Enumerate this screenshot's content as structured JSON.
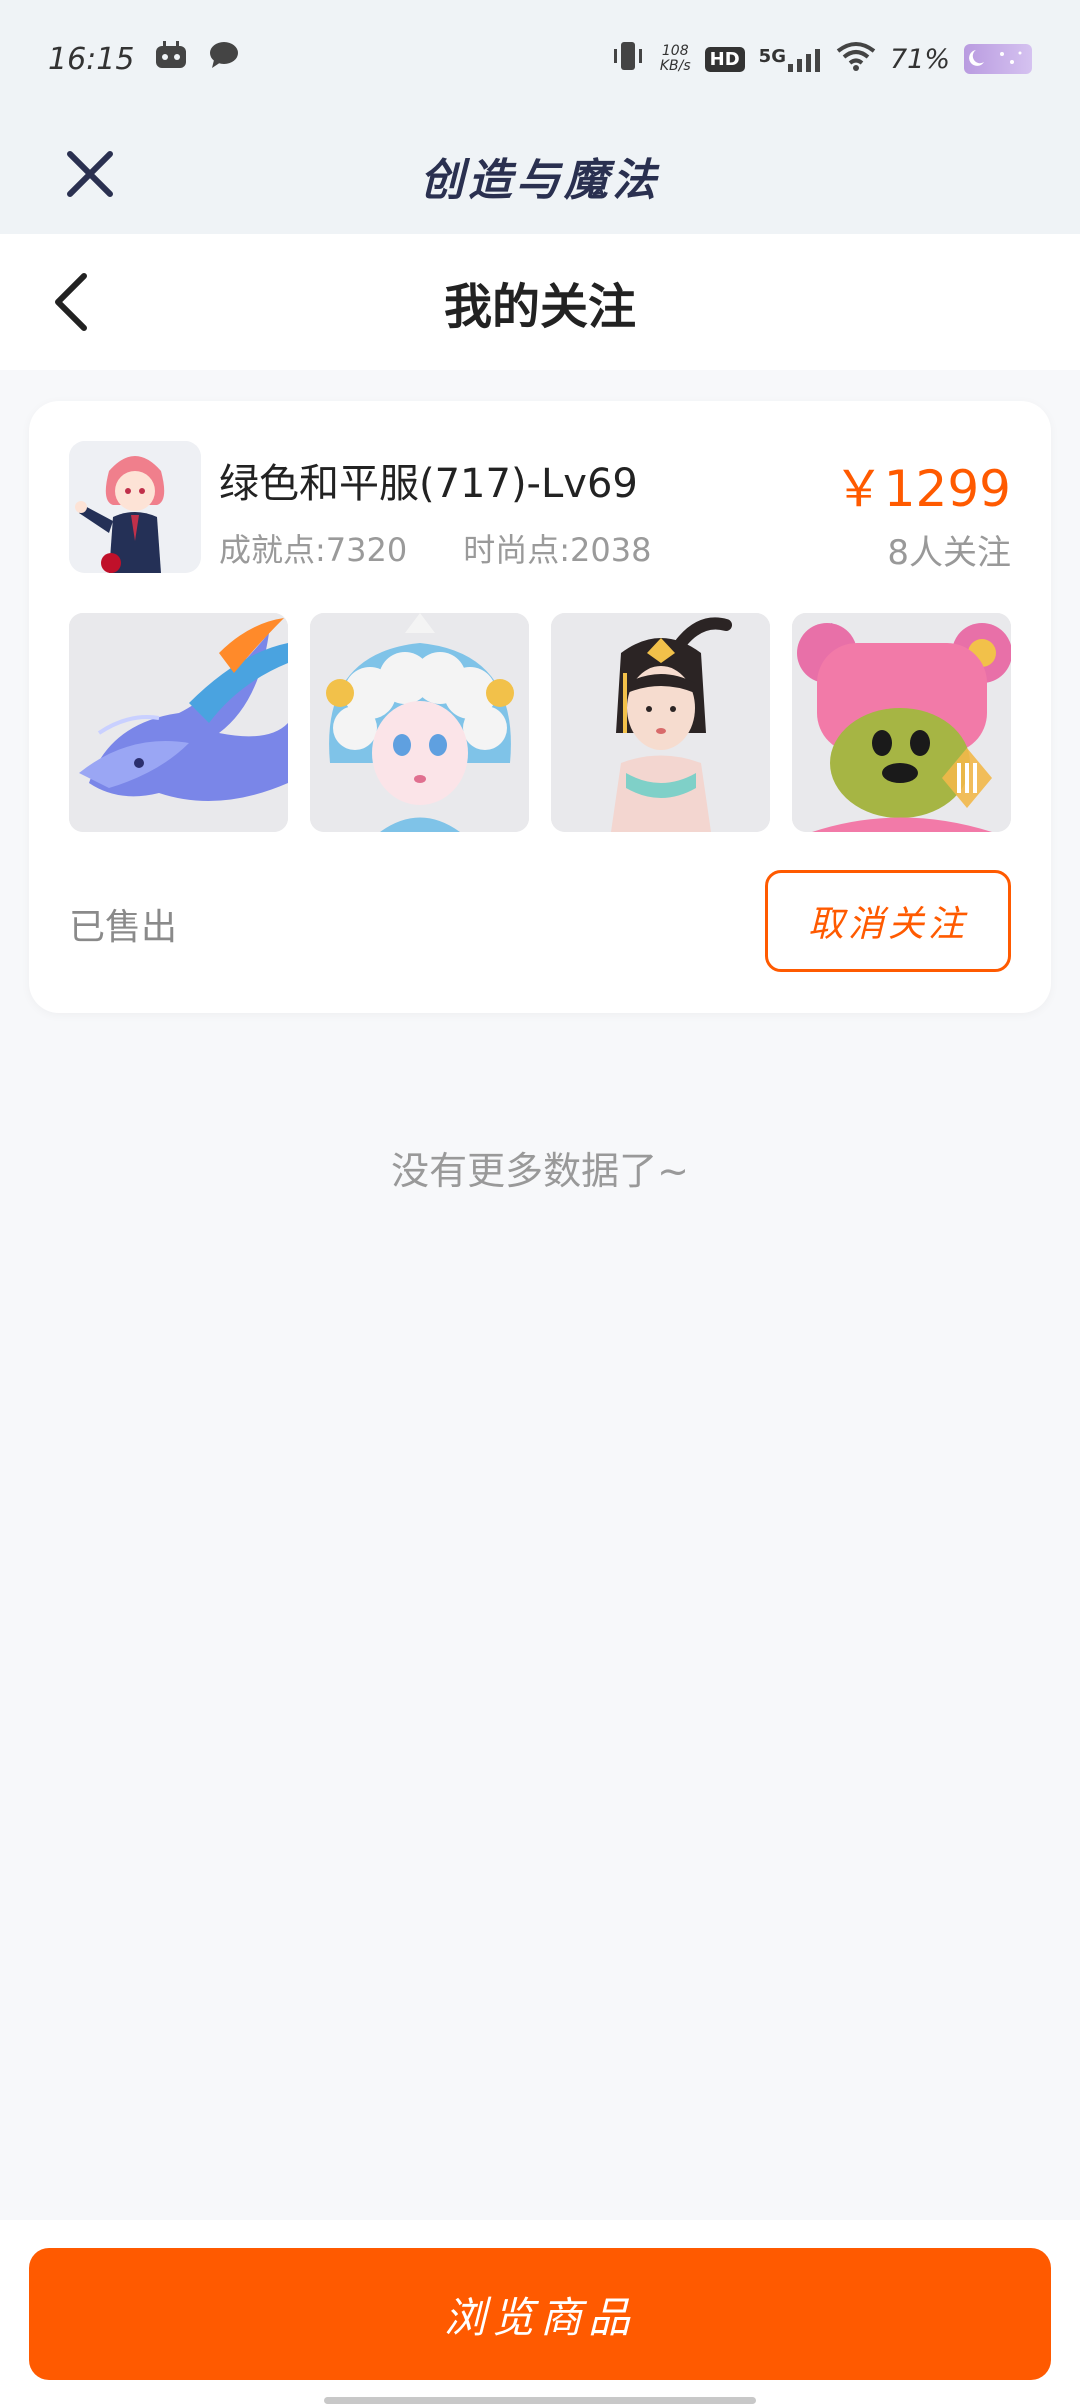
{
  "status_bar": {
    "time": "16:15",
    "net_speed_value": "108",
    "net_speed_unit": "KB/s",
    "hd": "HD",
    "signal": "5G",
    "battery_pct": "71%"
  },
  "app": {
    "title": "创造与魔法"
  },
  "page": {
    "title": "我的关注"
  },
  "card": {
    "role_name": "绿色和平服(717)-Lv69",
    "achievement": "成就点:7320",
    "fashion": "时尚点:2038",
    "price": "￥1299",
    "followers": "8人关注",
    "status": "已售出",
    "unfollow_label": "取消关注",
    "thumbnails": [
      "dragon-mount-image",
      "cloud-hair-avatar-image",
      "hanfu-girl-image",
      "pink-bear-pet-image"
    ]
  },
  "list_end_text": "没有更多数据了~",
  "bottom": {
    "browse_label": "浏览商品"
  },
  "colors": {
    "accent": "#ff5a00",
    "header_bg": "#eff3f6",
    "page_bg": "#f7f8fa"
  }
}
